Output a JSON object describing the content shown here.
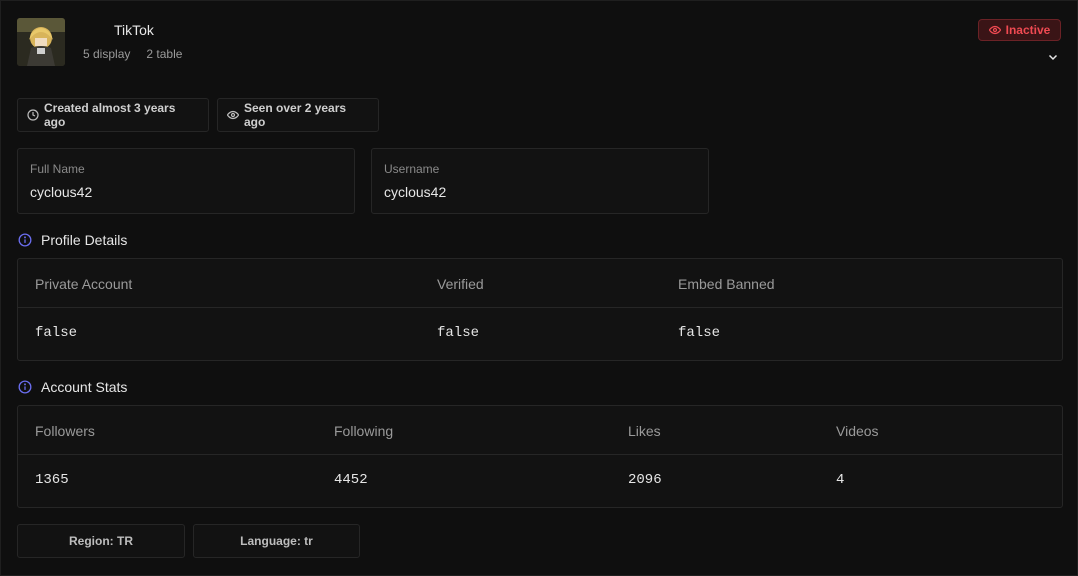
{
  "header": {
    "platform": "TikTok",
    "meta": [
      "5 display",
      "2 table"
    ],
    "status": "Inactive"
  },
  "timeline": {
    "created": "Created almost 3 years ago",
    "seen": "Seen over 2 years ago"
  },
  "fields": [
    {
      "label": "Full Name",
      "value": "cyclous42"
    },
    {
      "label": "Username",
      "value": "cyclous42"
    }
  ],
  "profile_details": {
    "title": "Profile Details",
    "columns": [
      "Private Account",
      "Verified",
      "Embed Banned"
    ],
    "values": [
      "false",
      "false",
      "false"
    ]
  },
  "account_stats": {
    "title": "Account Stats",
    "columns": [
      "Followers",
      "Following",
      "Likes",
      "Videos"
    ],
    "values": [
      "1365",
      "4452",
      "2096",
      "4"
    ]
  },
  "chips": {
    "region": "Region: TR",
    "language": "Language: tr"
  },
  "colors": {
    "accent_info": "#6b6ef0",
    "status_red": "#ef4a52"
  },
  "icons": {
    "clock": "clock-icon",
    "eye": "eye-icon",
    "info": "info-icon",
    "chevron": "chevron-down-icon"
  }
}
